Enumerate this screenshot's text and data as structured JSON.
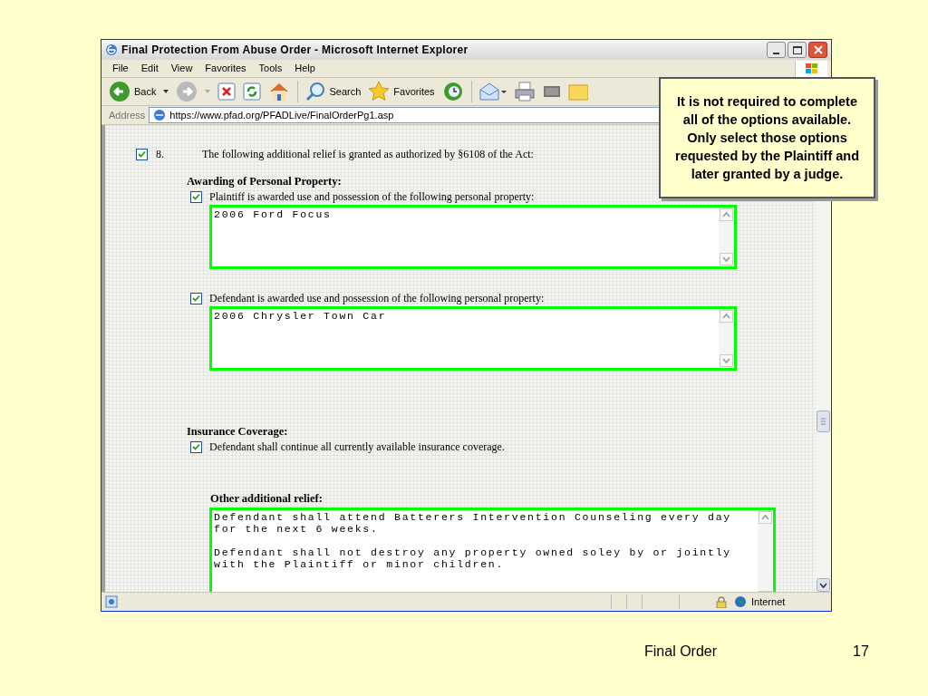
{
  "window": {
    "title": "Final Protection From Abuse Order - Microsoft Internet Explorer"
  },
  "menu": [
    "File",
    "Edit",
    "View",
    "Favorites",
    "Tools",
    "Help"
  ],
  "toolbar": [
    {
      "kind": "back",
      "label": "Back"
    },
    {
      "kind": "forward"
    },
    {
      "kind": "stop"
    },
    {
      "kind": "refresh"
    },
    {
      "kind": "home"
    },
    {
      "kind": "search",
      "label": "Search"
    },
    {
      "kind": "favorites",
      "label": "Favorites"
    },
    {
      "kind": "history"
    },
    {
      "kind": "mail"
    },
    {
      "kind": "print"
    },
    {
      "kind": "edit"
    },
    {
      "kind": "folder"
    }
  ],
  "address": {
    "label": "Address",
    "url": "https://www.pfad.org/PFADLive/FinalOrderPg1.asp"
  },
  "form": {
    "item": {
      "checked": true,
      "number": "8.",
      "text": "The following additional relief is granted as authorized by §6108 of the Act:"
    },
    "sections": [
      {
        "heading": "Awarding of Personal Property:",
        "entries": [
          {
            "kind": "checkbox_field",
            "checked": true,
            "label": "Plaintiff is awarded use and possession of the following personal property:",
            "value": [
              "2006 Ford Focus"
            ]
          },
          {
            "kind": "checkbox_field",
            "checked": true,
            "label": "Defendant is awarded use and possession of the following personal property:",
            "value": [
              "2006 Chrysler Town Car"
            ]
          }
        ]
      },
      {
        "heading": "Insurance Coverage:",
        "entries": [
          {
            "kind": "checkbox",
            "checked": true,
            "label": "Defendant shall continue all currently available insurance coverage."
          }
        ]
      },
      {
        "heading": "Other additional relief:",
        "entries": [
          {
            "kind": "field",
            "value": [
              "Defendant shall attend Batterers Intervention Counseling every day for the next 6 weeks.",
              "Defendant shall not destroy any property owned soley by or jointly with the Plaintiff or minor children."
            ]
          }
        ]
      }
    ]
  },
  "status_bar": {
    "zone": "Internet"
  },
  "callout": "It is not required to complete all of the options available. Only select those options requested by the Plaintiff and later granted by a judge.",
  "footer": {
    "title": "Final Order",
    "page": "17"
  }
}
